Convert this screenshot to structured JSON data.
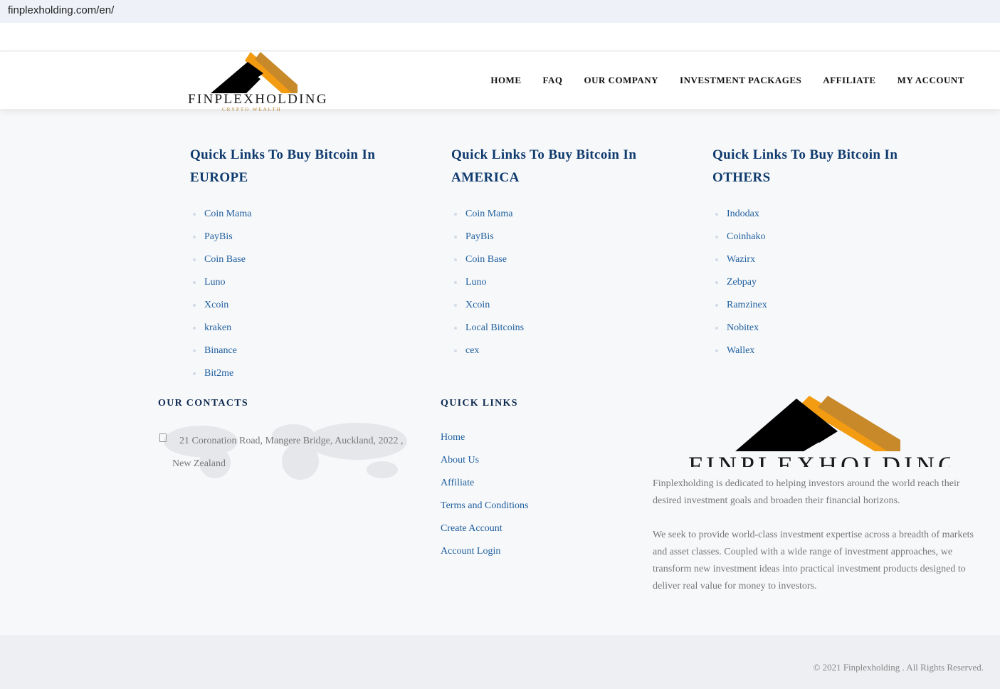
{
  "browser": {
    "url": "finplexholding.com/en/"
  },
  "header": {
    "brand": "FINPLEXHOLDING",
    "tagline": "CRYPTO WEALTH",
    "nav": [
      "HOME",
      "FAQ",
      "OUR COMPANY",
      "INVESTMENT PACKAGES",
      "AFFILIATE",
      "MY ACCOUNT"
    ]
  },
  "columns": [
    {
      "title_line1": "Quick Links To Buy Bitcoin In",
      "title_line2": "EUROPE",
      "links": [
        "Coin Mama",
        "PayBis",
        "Coin Base",
        "Luno",
        "Xcoin",
        "kraken",
        "Binance",
        "Bit2me"
      ]
    },
    {
      "title_line1": "Quick Links To Buy Bitcoin In",
      "title_line2": "AMERICA",
      "links": [
        "Coin Mama",
        "PayBis",
        "Coin Base",
        "Luno",
        "Xcoin",
        "Local Bitcoins",
        "cex"
      ]
    },
    {
      "title_line1": "Quick Links To Buy Bitcoin In",
      "title_line2": "OTHERS",
      "links": [
        "Indodax",
        "Coinhako",
        "Wazirx",
        "Zebpay",
        "Ramzinex",
        "Nobitex",
        "Wallex"
      ]
    }
  ],
  "contacts": {
    "title": "OUR CONTACTS",
    "pin_glyph": "",
    "address_line1": "21 Coronation Road, Mangere Bridge, Auckland, 2022 ,",
    "address_line2": "New Zealand"
  },
  "quick_links": {
    "title": "QUICK LINKS",
    "items": [
      "Home",
      "About Us",
      "Affiliate",
      "Terms and Conditions",
      "Create Account",
      "Account Login"
    ]
  },
  "about": {
    "brand": "FINPLEXHOLDING",
    "p1": "Finplexholding is dedicated to helping investors around the world reach their desired investment goals and broaden their financial horizons.",
    "p2": "We seek to provide world-class investment expertise across a breadth of markets and asset classes. Coupled with a wide range of investment approaches, we transform new investment ideas into practical investment products designed to deliver real value for money to investors."
  },
  "footer": {
    "copyright": "© 2021 Finplexholding . All Rights Reserved."
  },
  "colors": {
    "accent_orange": "#f39c12",
    "accent_gold": "#c8892a",
    "heading_blue": "#0e3a6e",
    "link_blue": "#1f5f9e"
  }
}
